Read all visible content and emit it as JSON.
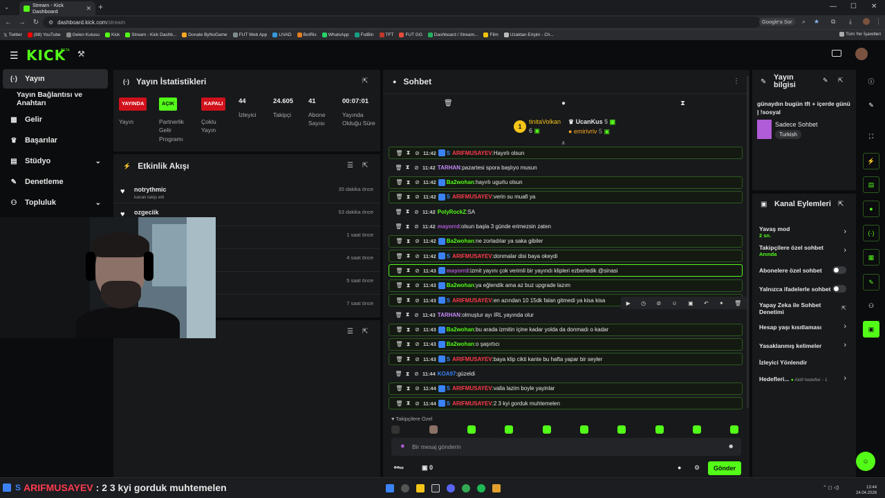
{
  "browser": {
    "tab_title": "Stream - Kick Dashboard",
    "url": "dashboard.kick.com",
    "url_path": "/stream",
    "google_search": "Google'a Sor",
    "bookmarks": [
      "Twitter",
      "(88) YouTube",
      "Gelen Kutusu",
      "Kick",
      "Stream - Kick Dashb...",
      "Donate ByNoGame",
      "FUT Web App",
      "LIVAD",
      "BotRix",
      "WhatsApp",
      "FutBin",
      "TFT",
      "FUT GG",
      "Dashboard / Stream...",
      "Film",
      "Uzaktan Erişim - Ch..."
    ],
    "all_bookmarks": "Tüm Yer İşaretleri"
  },
  "app": {
    "logo": "KICK",
    "beta": "BETA"
  },
  "sidebar": {
    "items": [
      {
        "label": "Yayın",
        "icon": "broadcast-icon"
      },
      {
        "label": "Yayın Bağlantısı ve Anahtarı",
        "icon": ""
      },
      {
        "label": "Gelir",
        "icon": "money-icon"
      },
      {
        "label": "Başarılar",
        "icon": "trophy-icon"
      },
      {
        "label": "Stüdyo",
        "icon": "studio-icon"
      },
      {
        "label": "Denetleme",
        "icon": "wrench-icon"
      },
      {
        "label": "Topluluk",
        "icon": "community-icon"
      }
    ]
  },
  "stats": {
    "title": "Yayın İstatistikleri",
    "items": [
      {
        "badge": "YAYINDA",
        "label": "Yayın"
      },
      {
        "badge": "AÇIK",
        "label": "Partnerlik Gelir Programı"
      },
      {
        "badge": "KAPALI",
        "label": "Çoklu Yayın"
      },
      {
        "value": "44",
        "label": "İzleyici"
      },
      {
        "value": "24.605",
        "label": "Takipçi"
      },
      {
        "value": "41",
        "label": "Abone Sayısı"
      },
      {
        "value": "00:07:01",
        "label": "Yayında Olduğu Süre"
      }
    ]
  },
  "activity": {
    "title": "Etkinlik Akışı",
    "events": [
      {
        "name": "notrythmic",
        "sub": "kanalı takip etti",
        "time": "35 dakika önce"
      },
      {
        "name": "ozgeciik",
        "sub": "",
        "time": "53 dakika önce"
      },
      {
        "name": "",
        "sub": "",
        "time": "1 saat önce"
      },
      {
        "name": "",
        "sub": "",
        "time": "4 saat önce"
      },
      {
        "name": "",
        "sub": "",
        "time": "5 saat önce"
      },
      {
        "name": "",
        "sub": "",
        "time": "7 saat önce"
      }
    ]
  },
  "chat": {
    "title": "Sohbet",
    "top_supporters": [
      {
        "rank": "1",
        "name": "tinitaVolkan",
        "count": "6"
      },
      {
        "name": "UcanKus",
        "count": "5"
      },
      {
        "name": "emirivriv",
        "count": "5"
      }
    ],
    "messages": [
      {
        "time": "11:42",
        "user": "ARIFMUSAYEV",
        "color": "#ff3a4f",
        "text": "Hayırlı olsun",
        "hl": true
      },
      {
        "time": "11:42",
        "user": "TARHAN",
        "color": "#c58af9",
        "text": "pazartesi spora başlıyo musun",
        "hl": false
      },
      {
        "time": "11:42",
        "user": "Ba2wohan",
        "color": "#53fc18",
        "text": "hayırlı ugurlu olsun",
        "hl": true
      },
      {
        "time": "11:42",
        "user": "ARIFMUSAYEV",
        "color": "#ff3a4f",
        "text": "verin su muafi ya",
        "hl": true
      },
      {
        "time": "11:42",
        "user": "PolyRockZ",
        "color": "#53fc18",
        "text": "SA",
        "hl": false
      },
      {
        "time": "11:42",
        "user": "mayorrd",
        "color": "#b05bd8",
        "text": "olsun başla 3 günde erimezsin zaten",
        "hl": false
      },
      {
        "time": "11:42",
        "user": "Ba2wohan",
        "color": "#53fc18",
        "text": "ne zorladılar ya saka gibiler",
        "hl": true
      },
      {
        "time": "11:42",
        "user": "ARIFMUSAYEV",
        "color": "#ff3a4f",
        "text": "donmalar disi baya okeydi",
        "hl": true
      },
      {
        "time": "11:43",
        "user": "mayorrd",
        "color": "#b05bd8",
        "text": "izmit yayını çok verimli bir yayındı klipleri ezberledik @sinasi",
        "hl2": true
      },
      {
        "time": "11:43",
        "user": "Ba2wohan",
        "color": "#53fc18",
        "text": "ya eğlendik ama az buz upgrade lazım",
        "hl": true
      },
      {
        "time": "11:43",
        "user": "ARIFMUSAYEV",
        "color": "#ff3a4f",
        "text": "en azından 10 15dk falan gitmedi ya kisa kisa",
        "hl": true
      },
      {
        "time": "11:43",
        "user": "TARHAN",
        "color": "#c58af9",
        "text": "olmuştur ayı IRL yayında olur",
        "hl": false
      },
      {
        "time": "11:43",
        "user": "Ba2wohan",
        "color": "#53fc18",
        "text": "bu arada izmitin içine kadar yolda da donmadı o kadar",
        "hl": true
      },
      {
        "time": "11:43",
        "user": "Ba2wohan",
        "color": "#53fc18",
        "text": "o şaşırtıcı",
        "hl": true
      },
      {
        "time": "11:43",
        "user": "ARIFMUSAYEV",
        "color": "#ff3a4f",
        "text": "baya klip cikti kante bu hafta yapar bir seyler",
        "hl": true
      },
      {
        "time": "11:44",
        "user": "KOA97",
        "color": "#3b82f6",
        "text": "güzeldi",
        "hl": false
      },
      {
        "time": "11:44",
        "user": "ARIFMUSAYEV",
        "color": "#ff3a4f",
        "text": "valla lazim boyle yayinlar",
        "hl": true
      },
      {
        "time": "11:44",
        "user": "ARIFMUSAYEV",
        "color": "#ff3a4f",
        "text": "2 3 kyi gorduk muhtemelen",
        "hl": true
      }
    ],
    "followers_only": "Takipçilere Özel",
    "input_placeholder": "Bir mesaj gönderin",
    "points": "0",
    "send": "Gönder"
  },
  "stream_info": {
    "title": "Yayın bilgisi",
    "stream_title": "günaydın bugün tft + içerde günü | !sosyal",
    "category": "Sadece Sohbet",
    "tag": "Turkish"
  },
  "channel_actions": {
    "title": "Kanal Eylemleri",
    "rows": [
      {
        "label": "Yavaş mod",
        "value": "2 sn.",
        "type": "arrow"
      },
      {
        "label": "Takipçilere özel sohbet",
        "value": "Anında",
        "type": "arrow"
      },
      {
        "label": "Abonelere özel sohbet",
        "value": "",
        "type": "toggle"
      },
      {
        "label": "Yalnızca ifadelerle sohbet",
        "value": "",
        "type": "toggle"
      },
      {
        "label": "Yapay Zeka ile Sohbet Denetimi",
        "value": "",
        "type": "link"
      },
      {
        "label": "Hesap yaşı kısıtlaması",
        "value": "",
        "type": "arrow"
      },
      {
        "label": "Yasaklanmış kelimeler",
        "value": "",
        "type": "arrow"
      },
      {
        "label": "İzleyici Yönlendir",
        "value": "",
        "type": "none"
      },
      {
        "label": "Hedefleri...",
        "value": "Aktif hedefler - 1",
        "type": "arrow"
      }
    ]
  },
  "ticker": {
    "user": "ARIFMUSAYEV",
    "text": ": 2 3 kyi gorduk muhtemelen"
  },
  "clock": {
    "time": "13:44",
    "date": "24.04.2026"
  },
  "colors": {
    "accent": "#53fc18",
    "live": "#d0111b",
    "panel": "#18191b"
  }
}
